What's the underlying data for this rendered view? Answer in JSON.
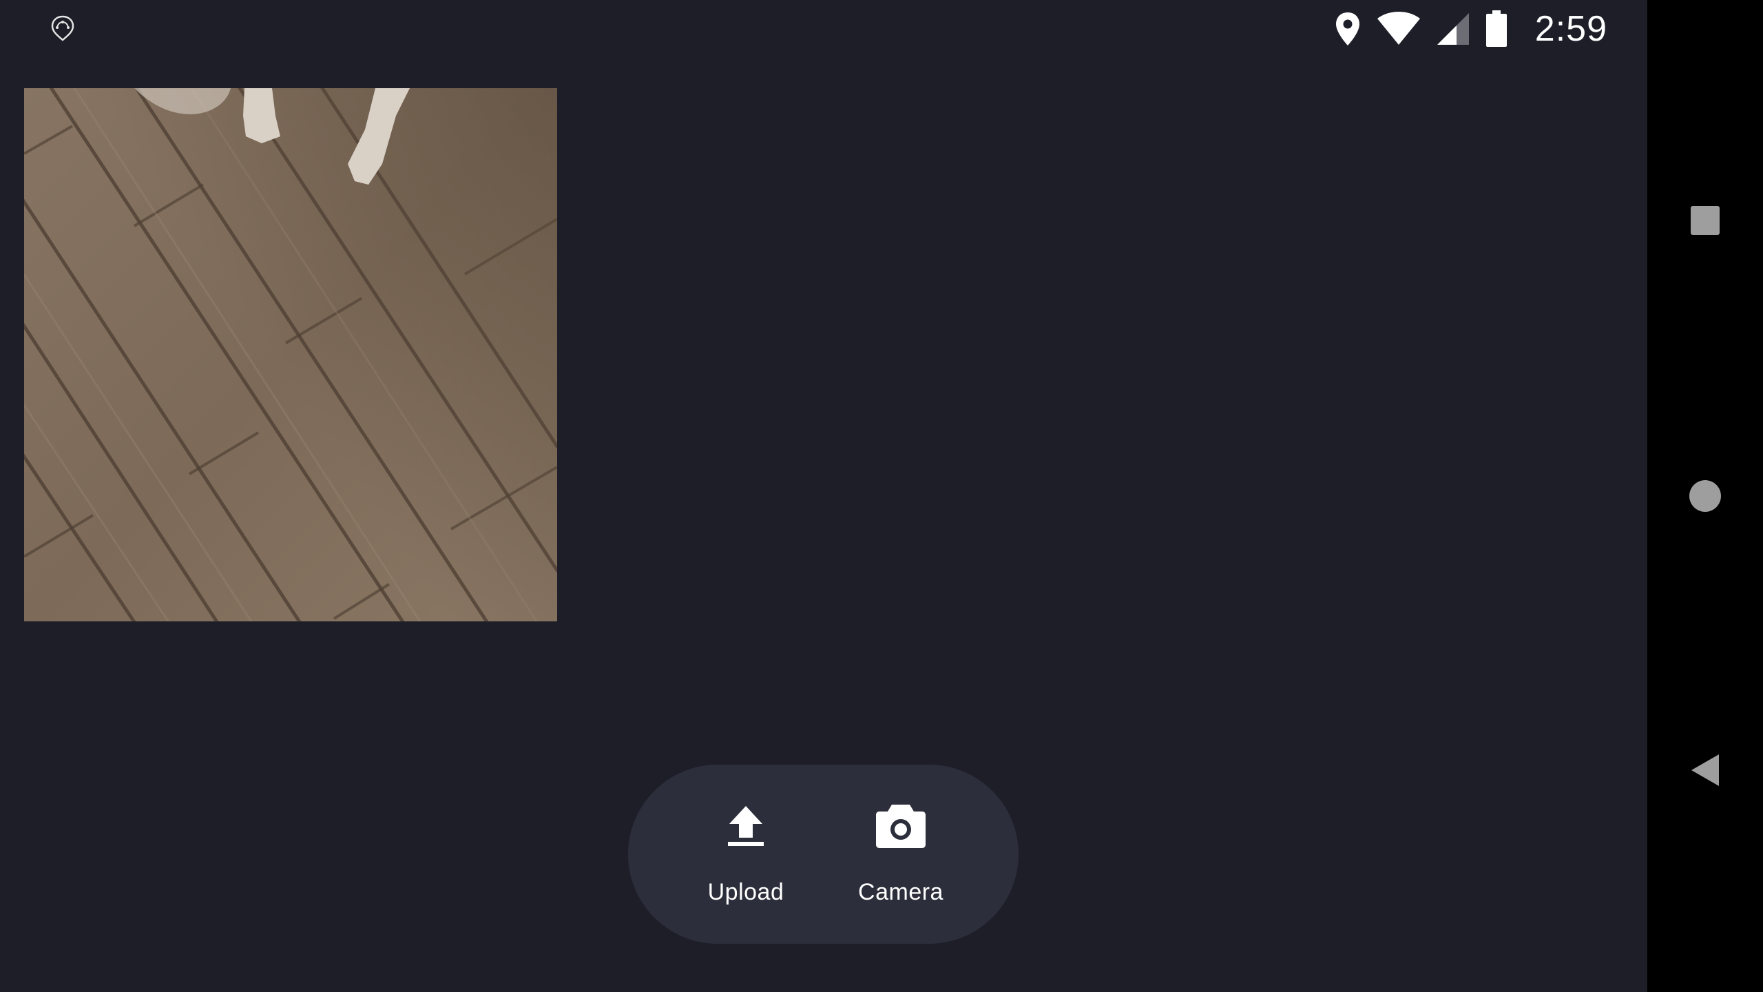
{
  "status_bar": {
    "time": "2:59",
    "icons": [
      "app-notification-icon",
      "location-icon",
      "wifi-icon",
      "cell-signal-icon",
      "battery-icon"
    ]
  },
  "preview": {
    "description_icon": "photo-preview"
  },
  "actions": {
    "upload_label": "Upload",
    "upload_icon": "upload-icon",
    "camera_label": "Camera",
    "camera_icon": "camera-icon"
  },
  "nav_bar": {
    "recents_icon": "square-icon",
    "home_icon": "circle-icon",
    "back_icon": "triangle-back-icon"
  },
  "colors": {
    "background": "#1d1e28",
    "pill": "#2c2e3b",
    "nav_bar": "#000000",
    "nav_icon": "#9e9e9e",
    "text": "#ffffff"
  }
}
